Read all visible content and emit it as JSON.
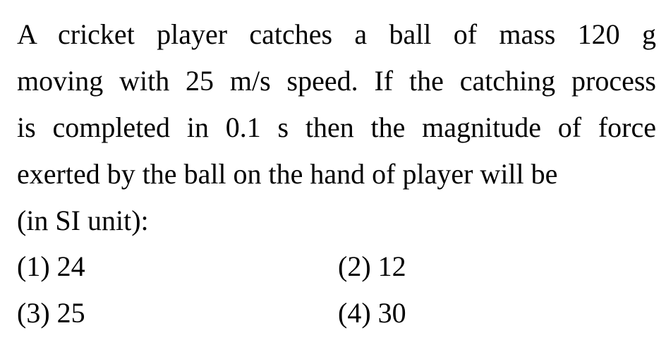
{
  "question": {
    "lines": [
      "A cricket player catches a ball of mass 120 g",
      "moving with 25 m/s speed. If the catching process",
      "is completed in 0.1 s then the magnitude of force",
      "exerted by the ball on the hand of player will be",
      "(in SI unit):"
    ]
  },
  "options": [
    {
      "label": "(1) 24"
    },
    {
      "label": "(2) 12"
    },
    {
      "label": "(3) 25"
    },
    {
      "label": "(4) 30"
    }
  ]
}
